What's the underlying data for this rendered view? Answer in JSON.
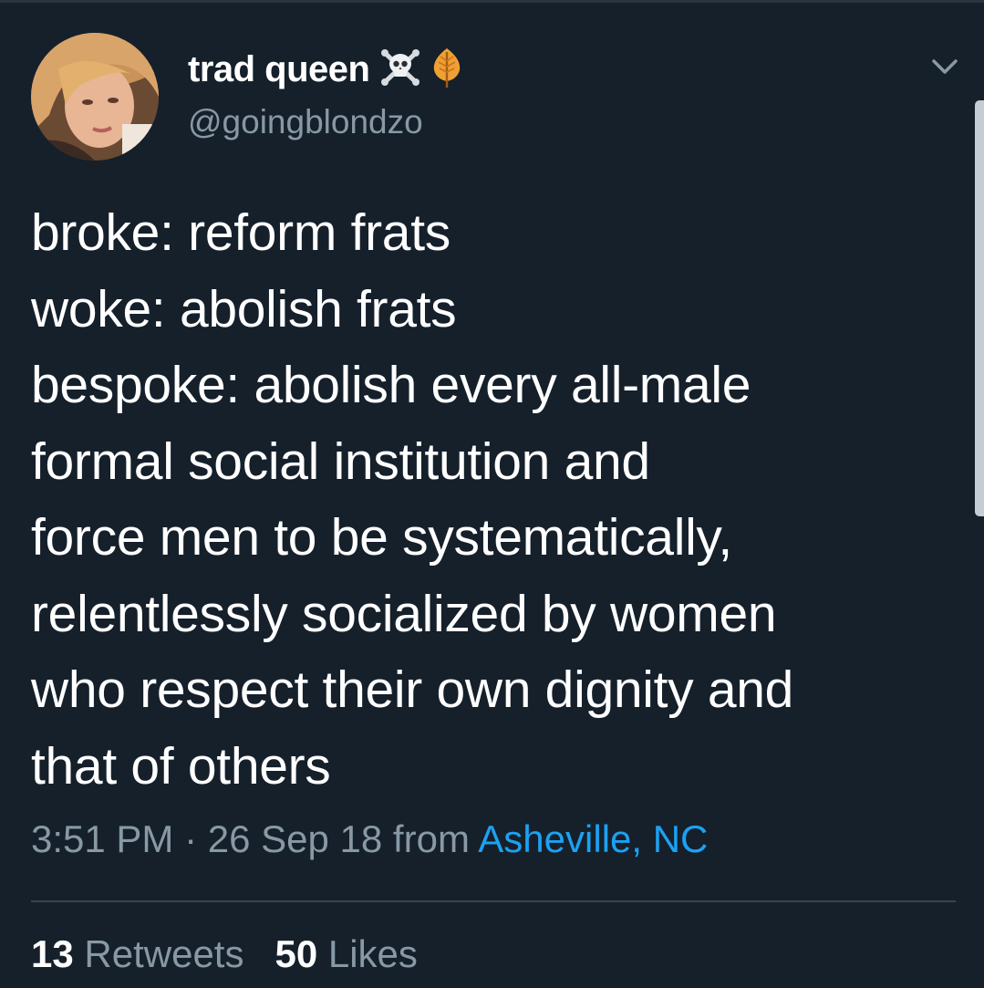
{
  "tweet": {
    "author": {
      "display_name": "trad queen",
      "name_emojis": [
        "skull-and-crossbones-icon",
        "orange-leaf-icon"
      ],
      "handle": "@goingblondzo"
    },
    "text_lines": [
      "broke: reform frats",
      "woke: abolish frats",
      "bespoke: abolish every all-male",
      "formal social institution and",
      "force men to be systematically,",
      "relentlessly socialized by women",
      "who respect their own dignity and",
      "that of others"
    ],
    "time": "3:51 PM",
    "separator": " · ",
    "date": "26 Sep 18",
    "from_label": " from ",
    "location": "Asheville, NC",
    "stats": {
      "retweets_count": "13",
      "retweets_label": "Retweets",
      "likes_count": "50",
      "likes_label": "Likes"
    }
  },
  "colors": {
    "background": "#15202b",
    "primary_text": "#ffffff",
    "secondary_text": "#8899a6",
    "link": "#1da1f2",
    "divider": "#38444d"
  },
  "icons": {
    "menu": "chevron-down-icon"
  }
}
